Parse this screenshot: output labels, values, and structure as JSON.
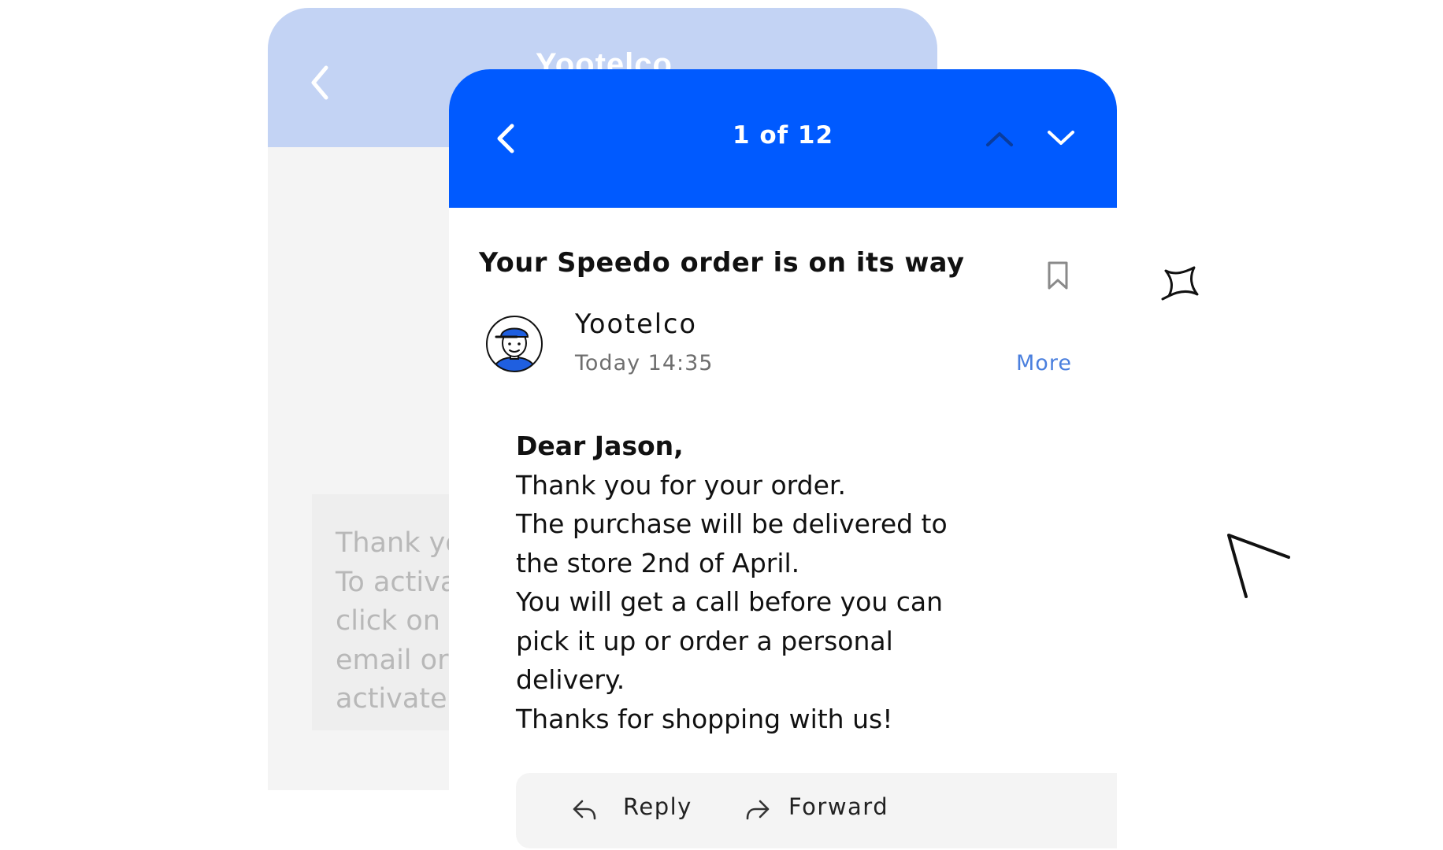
{
  "background_screen": {
    "title": "Yootelco",
    "body_lines": [
      "Thank yo",
      "To activa",
      "click on t",
      "email or",
      "activate i"
    ]
  },
  "email_screen": {
    "header": {
      "counter": "1 of 12",
      "color": "#005aff"
    },
    "subject": "Your Speedo order is on its way",
    "sender": {
      "name": "Yootelco",
      "time": "Today 14:35",
      "more_label": "More"
    },
    "body": {
      "greeting": "Dear Jason,",
      "lines": [
        "Thank you for your order.",
        "The purchase will be delivered to",
        "the store 2nd of April.",
        "You will get a call before you can",
        "pick it up or order a personal",
        "delivery.",
        "Thanks for shopping with us!"
      ]
    },
    "actions": {
      "reply_label": "Reply",
      "forward_label": "Forward"
    }
  },
  "icons": {
    "back": "chevron-left-icon",
    "previous": "chevron-up-icon",
    "next": "chevron-down-icon",
    "bookmark": "bookmark-icon",
    "avatar": "avatar-illustration",
    "reply": "reply-icon",
    "forward": "forward-icon"
  },
  "colors": {
    "accent": "#005aff",
    "faded_header": "#c3d3f4",
    "link": "#4a7fde",
    "action_bar": "#f4f4f4"
  }
}
